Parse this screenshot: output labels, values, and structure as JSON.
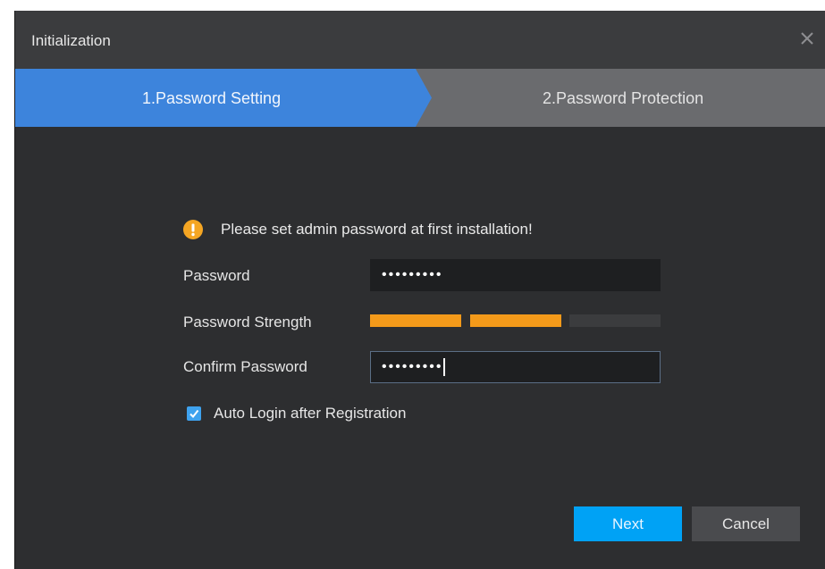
{
  "window": {
    "title": "Initialization"
  },
  "steps": [
    {
      "label": "1.Password Setting",
      "active": true
    },
    {
      "label": "2.Password Protection",
      "active": false
    }
  ],
  "form": {
    "warning": "Please set admin password at first installation!",
    "password_label": "Password",
    "password_value": "•••••••••",
    "strength_label": "Password Strength",
    "strength_level": "2 of 3",
    "confirm_label": "Confirm Password",
    "confirm_value": "•••••••••",
    "auto_login_label": "Auto Login after Registration",
    "auto_login_checked": true
  },
  "buttons": {
    "next": "Next",
    "cancel": "Cancel"
  },
  "colors": {
    "active_step": "#3d84dc",
    "inactive_step": "#6a6b6e",
    "strength_on": "#f39a1a",
    "warning_icon": "#f5a623",
    "primary_button": "#00a2f5"
  },
  "icons": {
    "close": "close-icon",
    "warning": "warning-icon",
    "checkbox": "check-icon"
  }
}
